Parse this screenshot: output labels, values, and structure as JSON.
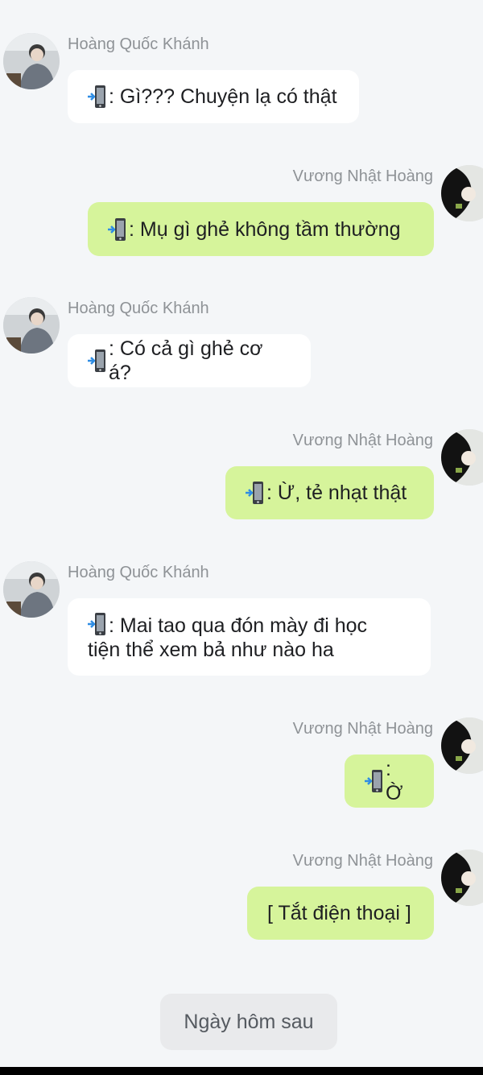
{
  "messages": [
    {
      "side": "left",
      "sender": "Hoàng Quốc Khánh",
      "icon": "mobile-phone-arrow-icon",
      "text": ": Gì??? Chuyện lạ có thật"
    },
    {
      "side": "right",
      "sender": "Vương Nhật Hoàng",
      "icon": "mobile-phone-arrow-icon",
      "text": ": Mụ gì ghẻ không tầm thường"
    },
    {
      "side": "left",
      "sender": "Hoàng Quốc Khánh",
      "icon": "mobile-phone-arrow-icon",
      "text": ": Có cả gì ghẻ cơ á?"
    },
    {
      "side": "right",
      "sender": "Vương Nhật Hoàng",
      "icon": "mobile-phone-arrow-icon",
      "text": ": Ừ, tẻ nhạt thật"
    },
    {
      "side": "left",
      "sender": "Hoàng Quốc Khánh",
      "icon": "mobile-phone-arrow-icon",
      "text": ": Mai tao qua đón mày đi học\ntiện thể xem bả như nào ha"
    },
    {
      "side": "right",
      "sender": "Vương Nhật Hoàng",
      "icon": "mobile-phone-arrow-icon",
      "text": ": Ờ"
    },
    {
      "side": "right",
      "sender": "Vương Nhật Hoàng",
      "icon": "",
      "text": "[ Tắt điện thoại ]"
    }
  ],
  "day_divider": "Ngày hôm sau",
  "colors": {
    "left_bubble": "#ffffff",
    "right_bubble": "#d6f49b",
    "background": "#f4f6f8",
    "name": "#8e9296"
  }
}
